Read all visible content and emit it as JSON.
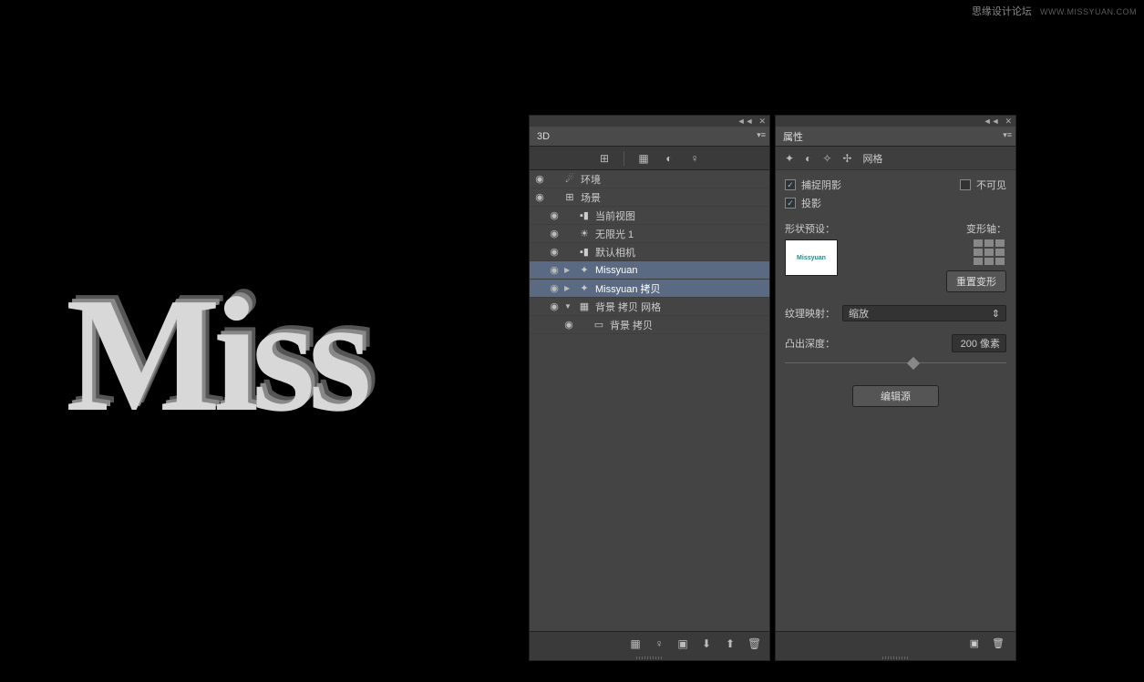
{
  "watermark": {
    "text": "思缘设计论坛",
    "url": "WWW.MISSYUAN.COM"
  },
  "canvas": {
    "text3d": "Miss"
  },
  "panel3d": {
    "tab": "3D",
    "tree": {
      "env": "环境",
      "scene": "场景",
      "currentView": "当前视图",
      "infLight": "无限光 1",
      "defCamera": "默认相机",
      "missyuan": "Missyuan",
      "missyuanCopy": "Missyuan 拷贝",
      "bgCopyMesh": "背景 拷贝 网格",
      "bgCopy": "背景 拷贝"
    }
  },
  "props": {
    "tab": "属性",
    "meshLabel": "网格",
    "captureShadow": "捕捉阴影",
    "invisible": "不可见",
    "castShadow": "投影",
    "shapePreset": "形状预设：",
    "shapePreview": "Missyuan",
    "deformAxis": "变形轴：",
    "resetDeform": "重置变形",
    "textureMap": "纹理映射：",
    "textureMapValue": "缩放",
    "extrudeDepth": "凸出深度：",
    "extrudeValue": "200 像素",
    "editSource": "编辑源"
  }
}
